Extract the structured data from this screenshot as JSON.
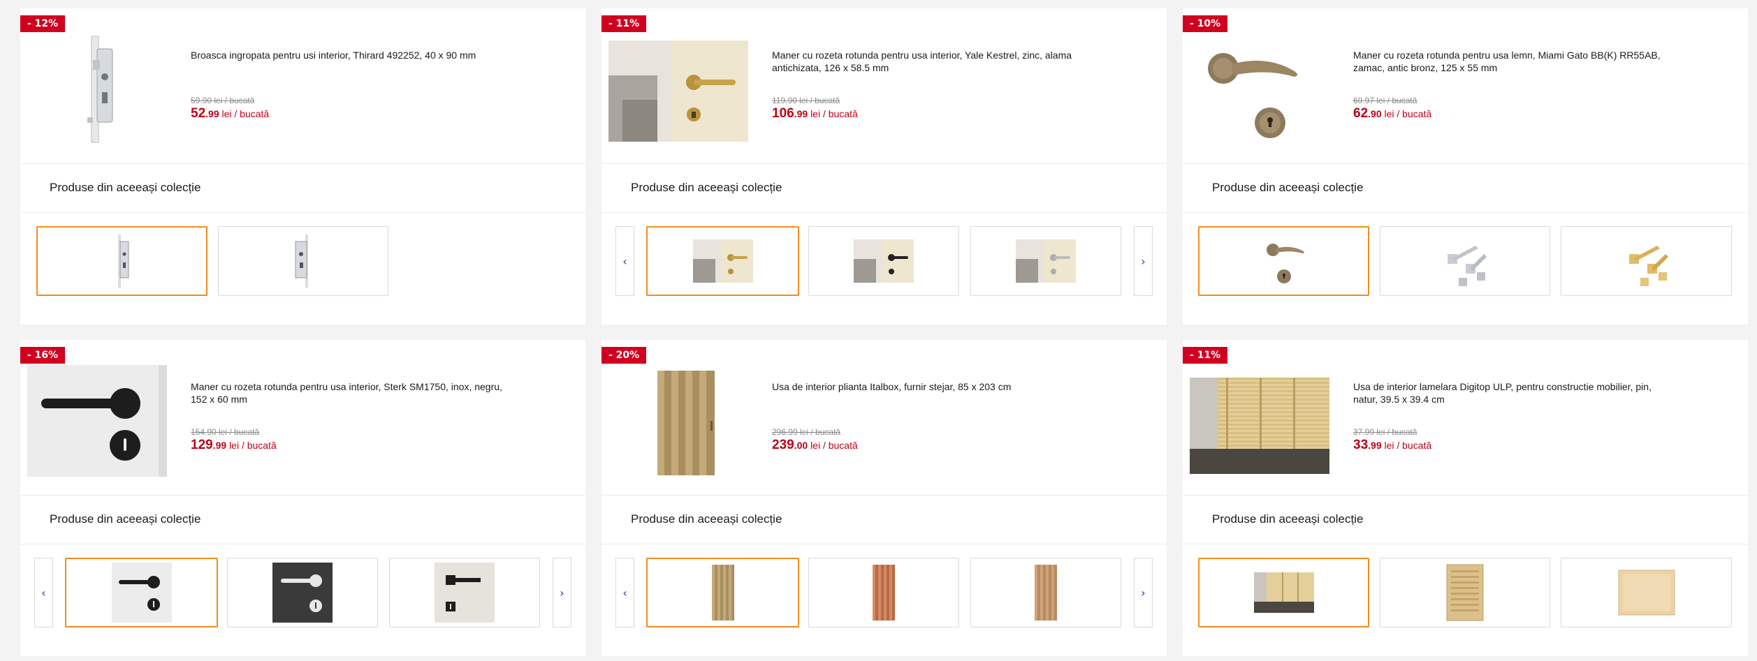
{
  "labels": {
    "currency_unit": "lei / bucată",
    "collection_title": "Produse din aceeași colecție",
    "prev_arrow": "‹",
    "next_arrow": "›"
  },
  "colors": {
    "badge": "#d1001f",
    "price": "#c00018",
    "active_border": "#f08c23",
    "arrow": "#1a3b8c"
  },
  "products": [
    {
      "badge": "- 12%",
      "name": "Broasca ingropata pentru usi interior, Thirard 492252, 40 x 90 mm",
      "old_price": "59.90 lei / bucată",
      "price_int": "52",
      "price_dec": ".99",
      "image_icon": "mortise-lock-icon",
      "thumbnails": [
        "mortise-lock-thumb",
        "mortise-lock-alt-thumb"
      ]
    },
    {
      "badge": "- 11%",
      "name": "Maner cu rozeta rotunda pentru usa interior, Yale Kestrel, zinc, alama antichizata, 126 x 58.5 mm",
      "old_price": "119.90 lei / bucată",
      "price_int": "106",
      "price_dec": ".99",
      "image_icon": "door-handle-brass-icon",
      "thumbnails": [
        "handle-brass-thumb",
        "handle-black-thumb",
        "handle-silver-thumb"
      ]
    },
    {
      "badge": "- 10%",
      "name": "Maner cu rozeta rotunda pentru usa lemn, Miami Gato BB(K) RR55AB, zamac, antic bronz, 125 x 55 mm",
      "old_price": "69.97 lei / bucată",
      "price_int": "62",
      "price_dec": ".90",
      "image_icon": "bronze-handle-icon",
      "thumbnails": [
        "bronze-handle-thumb",
        "chrome-handle-thumb",
        "gold-handle-thumb"
      ]
    },
    {
      "badge": "- 16%",
      "name": "Maner cu rozeta rotunda pentru usa interior, Sterk SM1750, inox, negru, 152 x 60 mm",
      "old_price": "154.90 lei / bucată",
      "price_int": "129",
      "price_dec": ".99",
      "image_icon": "black-handle-icon",
      "thumbnails": [
        "black-handle-thumb",
        "white-handle-dark-thumb",
        "square-black-handle-thumb"
      ]
    },
    {
      "badge": "- 20%",
      "name": "Usa de interior plianta Italbox, furnir stejar, 85 x 203 cm",
      "old_price": "296.99 lei / bucată",
      "price_int": "239",
      "price_dec": ".00",
      "image_icon": "folding-door-icon",
      "thumbnails": [
        "folding-door-oak-thumb",
        "folding-door-cherry-thumb",
        "folding-door-light-thumb"
      ]
    },
    {
      "badge": "- 11%",
      "name": "Usa de interior lamelara Digitop ULP, pentru constructie mobilier, pin, natur, 39.5 x 39.4 cm",
      "old_price": "37.99 lei / bucată",
      "price_int": "33",
      "price_dec": ".99",
      "image_icon": "louvered-door-icon",
      "thumbnails": [
        "louvered-room-thumb",
        "louvered-panel-thumb",
        "pine-panel-thumb"
      ]
    }
  ]
}
